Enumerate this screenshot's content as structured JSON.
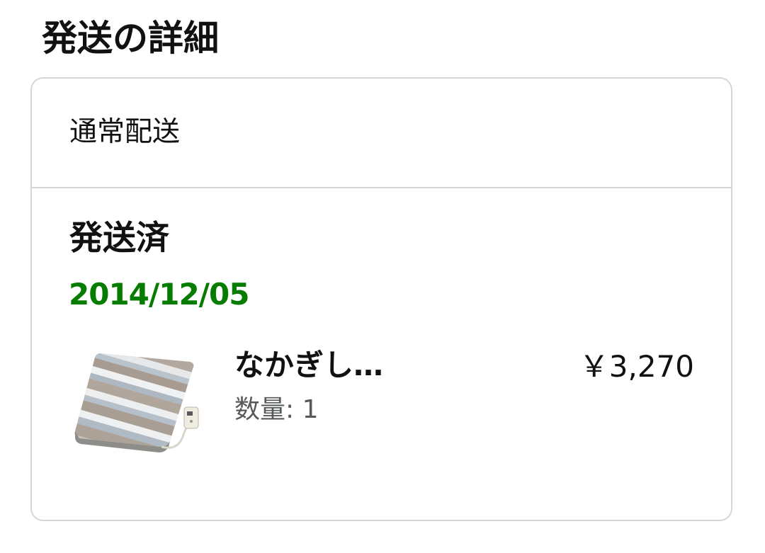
{
  "section_title": "発送の詳細",
  "shipment": {
    "method": "通常配送",
    "status": "発送済",
    "date": "2014/12/05",
    "item": {
      "image_icon": "electric-blanket-product-image",
      "name": "なかぎし…",
      "quantity_label": "数量: 1",
      "price": "￥3,270"
    }
  },
  "colors": {
    "date_green": "#067d00",
    "border": "#d5d6d6",
    "secondary_text": "#565959"
  }
}
